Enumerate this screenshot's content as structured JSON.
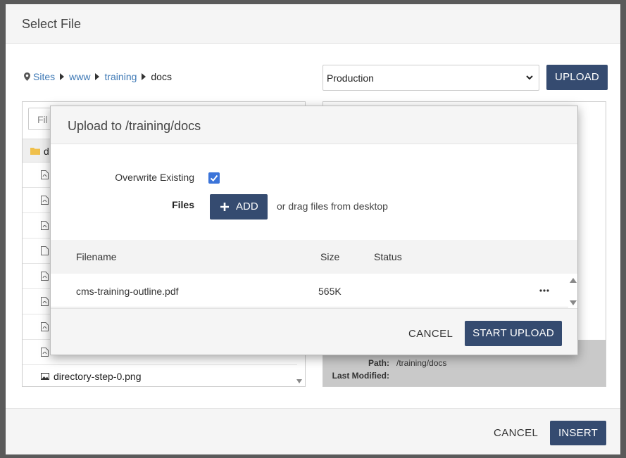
{
  "dialog": {
    "title": "Select File",
    "breadcrumb": [
      "Sites",
      "www",
      "training",
      "docs"
    ],
    "environment_select": "Production",
    "upload_label": "UPLOAD",
    "filter_placeholder": "Fil",
    "folder_label": "d",
    "last_file": "directory-step-0.png",
    "details": {
      "path_label": "Path:",
      "path_value": "/training/docs",
      "modified_label": "Last Modified:"
    },
    "cancel_label": "CANCEL",
    "insert_label": "INSERT"
  },
  "modal": {
    "title": "Upload to /training/docs",
    "overwrite_label": "Overwrite Existing",
    "overwrite_checked": true,
    "files_label": "Files",
    "add_label": "ADD",
    "drag_hint": "or drag files from desktop",
    "columns": {
      "filename": "Filename",
      "size": "Size",
      "status": "Status"
    },
    "rows": [
      {
        "filename": "cms-training-outline.pdf",
        "size": "565K",
        "status": ""
      }
    ],
    "cancel_label": "CANCEL",
    "start_label": "START UPLOAD"
  },
  "colors": {
    "primary": "#354b70",
    "link": "#3d78b5",
    "checkbox": "#3b74d9"
  }
}
